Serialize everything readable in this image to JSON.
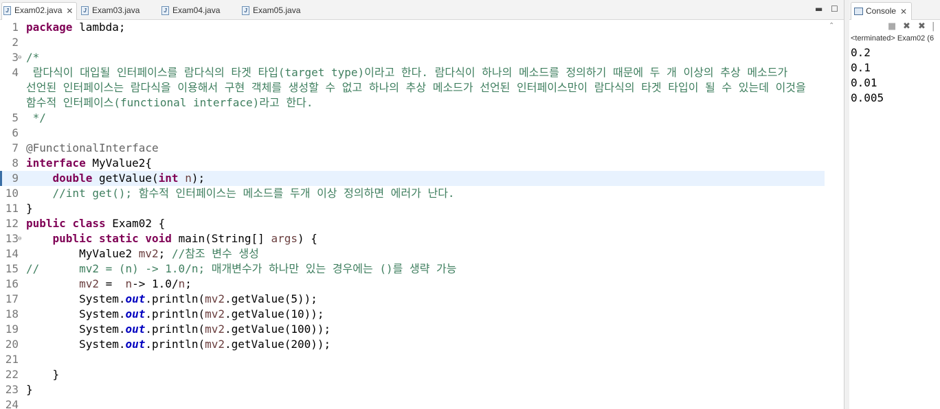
{
  "editor": {
    "tabs": [
      {
        "label": "Exam02.java",
        "active": true
      },
      {
        "label": "Exam03.java",
        "active": false
      },
      {
        "label": "Exam04.java",
        "active": false
      },
      {
        "label": "Exam05.java",
        "active": false
      }
    ],
    "minimize_glyph": "▬",
    "maximize_glyph": "☐",
    "current_line": 9,
    "lines": [
      {
        "n": "1",
        "fold": "",
        "segs": [
          [
            "kw",
            "package"
          ],
          [
            "pl",
            " lambda;"
          ]
        ]
      },
      {
        "n": "2",
        "fold": "",
        "segs": []
      },
      {
        "n": "3",
        "fold": "⊖",
        "segs": [
          [
            "cm",
            "/*"
          ]
        ]
      },
      {
        "n": "4",
        "fold": "",
        "segs": [
          [
            "cm",
            " 람다식이 대입될 인터페이스를 람다식의 타겟 타입(target type)이라고 한다. 람다식이 하나의 메소드를 정의하기 때문에 두 개 이상의 추상 메소드가"
          ]
        ]
      },
      {
        "n": "",
        "fold": "",
        "segs": [
          [
            "cm",
            "선언된 인터페이스는 람다식을 이용해서 구현 객체를 생성할 수 없고 하나의 추상 메소드가 선언된 인터페이스만이 람다식의 타겟 타입이 될 수 있는데 이것을"
          ]
        ]
      },
      {
        "n": "",
        "fold": "",
        "segs": [
          [
            "cm",
            "함수적 인터페이스(functional interface)라고 한다."
          ]
        ]
      },
      {
        "n": "5",
        "fold": "",
        "segs": [
          [
            "cm",
            " */"
          ]
        ]
      },
      {
        "n": "6",
        "fold": "",
        "segs": []
      },
      {
        "n": "7",
        "fold": "",
        "segs": [
          [
            "an",
            "@FunctionalInterface"
          ]
        ]
      },
      {
        "n": "8",
        "fold": "",
        "segs": [
          [
            "kw",
            "interface"
          ],
          [
            "pl",
            " MyValue2{"
          ]
        ]
      },
      {
        "n": "9",
        "fold": "",
        "segs": [
          [
            "pl",
            "    "
          ],
          [
            "kw",
            "double"
          ],
          [
            "pl",
            " getValue("
          ],
          [
            "kw",
            "int"
          ],
          [
            "pl",
            " "
          ],
          [
            "vr",
            "n"
          ],
          [
            "pl",
            ");"
          ]
        ]
      },
      {
        "n": "10",
        "fold": "",
        "segs": [
          [
            "pl",
            "    "
          ],
          [
            "cm",
            "//int get(); 함수적 인터페이스는 메소드를 두개 이상 정의하면 에러가 난다."
          ]
        ]
      },
      {
        "n": "11",
        "fold": "",
        "segs": [
          [
            "pl",
            "}"
          ]
        ]
      },
      {
        "n": "12",
        "fold": "",
        "segs": [
          [
            "kw",
            "public"
          ],
          [
            "pl",
            " "
          ],
          [
            "kw",
            "class"
          ],
          [
            "pl",
            " Exam02 {"
          ]
        ]
      },
      {
        "n": "13",
        "fold": "⊖",
        "segs": [
          [
            "pl",
            "    "
          ],
          [
            "kw",
            "public"
          ],
          [
            "pl",
            " "
          ],
          [
            "kw",
            "static"
          ],
          [
            "pl",
            " "
          ],
          [
            "kw",
            "void"
          ],
          [
            "pl",
            " main(String[] "
          ],
          [
            "vr",
            "args"
          ],
          [
            "pl",
            ") {"
          ]
        ]
      },
      {
        "n": "14",
        "fold": "",
        "segs": [
          [
            "pl",
            "        MyValue2 "
          ],
          [
            "vr",
            "mv2"
          ],
          [
            "pl",
            "; "
          ],
          [
            "cm",
            "//참조 변수 생성"
          ]
        ]
      },
      {
        "n": "15",
        "fold": "",
        "segs": [
          [
            "cm",
            "//      mv2 = (n) -> 1.0/n; 매개변수가 하나만 있는 경우에는 ()를 생략 가능"
          ]
        ]
      },
      {
        "n": "16",
        "fold": "",
        "segs": [
          [
            "pl",
            "        "
          ],
          [
            "vr",
            "mv2"
          ],
          [
            "pl",
            " =  "
          ],
          [
            "vr",
            "n"
          ],
          [
            "pl",
            "-> 1.0/"
          ],
          [
            "vr",
            "n"
          ],
          [
            "pl",
            ";"
          ]
        ]
      },
      {
        "n": "17",
        "fold": "",
        "segs": [
          [
            "pl",
            "        System."
          ],
          [
            "fi",
            "out"
          ],
          [
            "pl",
            ".println("
          ],
          [
            "vr",
            "mv2"
          ],
          [
            "pl",
            ".getValue(5));"
          ]
        ]
      },
      {
        "n": "18",
        "fold": "",
        "segs": [
          [
            "pl",
            "        System."
          ],
          [
            "fi",
            "out"
          ],
          [
            "pl",
            ".println("
          ],
          [
            "vr",
            "mv2"
          ],
          [
            "pl",
            ".getValue(10));"
          ]
        ]
      },
      {
        "n": "19",
        "fold": "",
        "segs": [
          [
            "pl",
            "        System."
          ],
          [
            "fi",
            "out"
          ],
          [
            "pl",
            ".println("
          ],
          [
            "vr",
            "mv2"
          ],
          [
            "pl",
            ".getValue(100));"
          ]
        ]
      },
      {
        "n": "20",
        "fold": "",
        "segs": [
          [
            "pl",
            "        System."
          ],
          [
            "fi",
            "out"
          ],
          [
            "pl",
            ".println("
          ],
          [
            "vr",
            "mv2"
          ],
          [
            "pl",
            ".getValue(200));"
          ]
        ]
      },
      {
        "n": "21",
        "fold": "",
        "segs": []
      },
      {
        "n": "22",
        "fold": "",
        "segs": [
          [
            "pl",
            "    }"
          ]
        ]
      },
      {
        "n": "23",
        "fold": "",
        "segs": [
          [
            "pl",
            "}"
          ]
        ]
      },
      {
        "n": "24",
        "fold": "",
        "segs": []
      }
    ]
  },
  "console": {
    "tab_label": "Console",
    "status": "<terminated> Exam02 (6",
    "output": [
      "0.2",
      "0.1",
      "0.01",
      "0.005"
    ]
  },
  "colors": {
    "keyword": "#7f0055",
    "comment": "#3f7f5f",
    "annotation": "#646464",
    "static_field": "#0000c0",
    "variable": "#6a3e3e",
    "current_line_bg": "#e8f2fe"
  }
}
